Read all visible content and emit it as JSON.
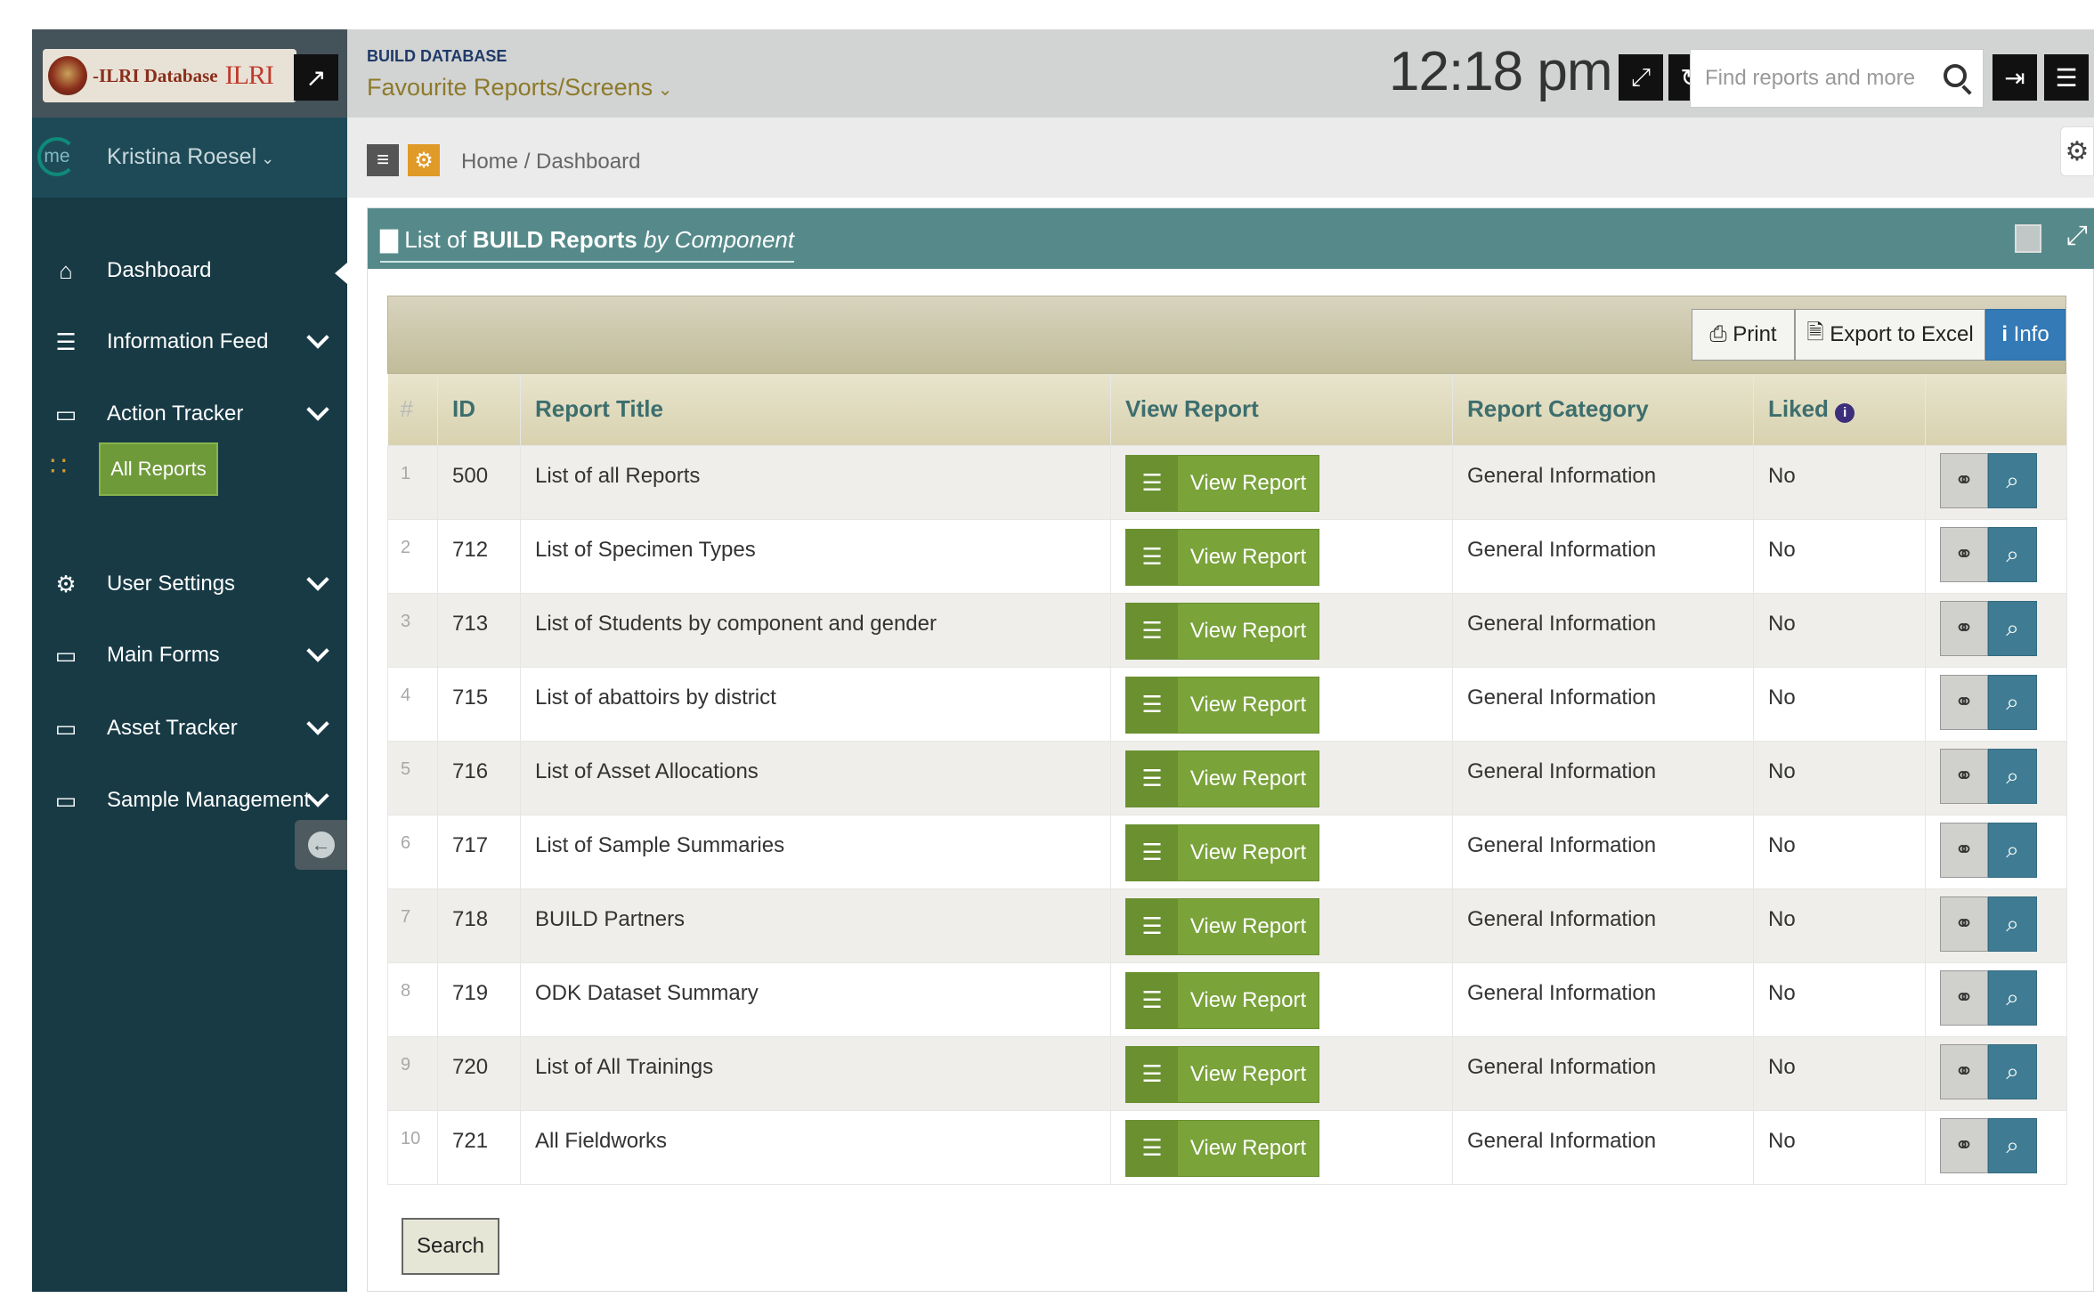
{
  "brand": {
    "logo_text": "-ILRI Database",
    "logo_mark": "ILRI"
  },
  "header": {
    "db_label": "BUILD DATABASE",
    "favourites_label": "Favourite Reports/Screens",
    "clock": "12:18 pm",
    "search_placeholder": "Find reports and more"
  },
  "user": {
    "avatar_text": "me",
    "name": "Kristina Roesel"
  },
  "sidebar": {
    "items": [
      {
        "label": "Dashboard",
        "icon": "home-icon"
      },
      {
        "label": "Information Feed",
        "icon": "sliders-icon"
      },
      {
        "label": "Action Tracker",
        "icon": "laptop-icon"
      },
      {
        "label": "All Reports",
        "icon": "rss-icon"
      },
      {
        "label": "User Settings",
        "icon": "cogs-icon"
      },
      {
        "label": "Main Forms",
        "icon": "desktop-icon"
      },
      {
        "label": "Asset Tracker",
        "icon": "laptop-icon"
      },
      {
        "label": "Sample Management",
        "icon": "laptop-icon"
      }
    ]
  },
  "breadcrumb": {
    "home": "Home /",
    "current": "Dashboard"
  },
  "panel": {
    "title_prefix": "List of",
    "title_bold": "BUILD Reports",
    "title_suffix": "by Component"
  },
  "toolbar": {
    "print_label": "Print",
    "excel_label": "Export to Excel",
    "info_label": "Info"
  },
  "table": {
    "columns": [
      "#",
      "ID",
      "Report Title",
      "View Report",
      "Report Category",
      "Liked"
    ],
    "rows": [
      {
        "num": "1",
        "id": "500",
        "title": "List of all Reports",
        "button": "View Report",
        "category": "General Information",
        "liked": "No"
      },
      {
        "num": "2",
        "id": "712",
        "title": "List of Specimen Types",
        "button": "View Report",
        "category": "General Information",
        "liked": "No"
      },
      {
        "num": "3",
        "id": "713",
        "title": "List of Students by component and gender",
        "button": "View Report",
        "category": "General Information",
        "liked": "No"
      },
      {
        "num": "4",
        "id": "715",
        "title": "List of abattoirs by district",
        "button": "View Report",
        "category": "General Information",
        "liked": "No"
      },
      {
        "num": "5",
        "id": "716",
        "title": "List of Asset Allocations",
        "button": "View Report",
        "category": "General Information",
        "liked": "No"
      },
      {
        "num": "6",
        "id": "717",
        "title": "List of Sample Summaries",
        "button": "View Report",
        "category": "General Information",
        "liked": "No"
      },
      {
        "num": "7",
        "id": "718",
        "title": "BUILD Partners",
        "button": "View Report",
        "category": "General Information",
        "liked": "No"
      },
      {
        "num": "8",
        "id": "719",
        "title": "ODK Dataset Summary",
        "button": "View Report",
        "category": "General Information",
        "liked": "No"
      },
      {
        "num": "9",
        "id": "720",
        "title": "List of All Trainings",
        "button": "View Report",
        "category": "General Information",
        "liked": "No"
      },
      {
        "num": "10",
        "id": "721",
        "title": "All Fieldworks",
        "button": "View Report",
        "category": "General Information",
        "liked": "No"
      }
    ]
  },
  "search_button": "Search",
  "colors": {
    "sidebar_bg": "#173a45",
    "panel_header": "#568a8a",
    "view_button": "#7aa33a",
    "info_button": "#337ab7",
    "accent_gold": "#8d7a2a"
  }
}
